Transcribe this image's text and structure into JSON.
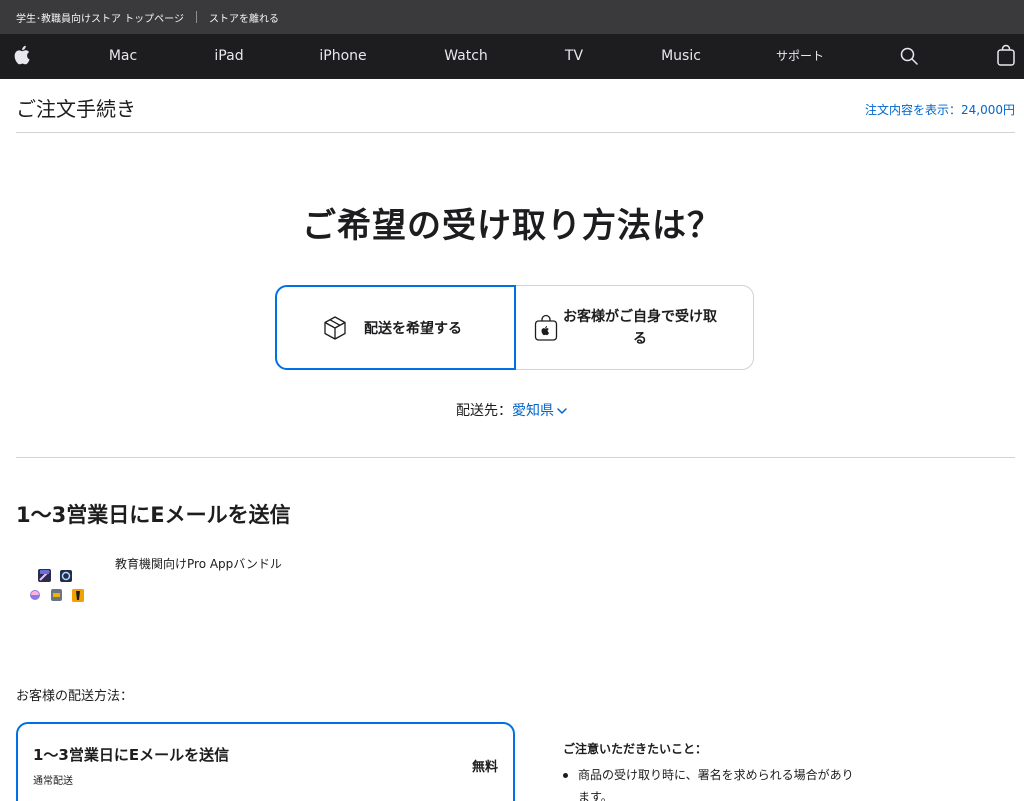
{
  "utility_bar": {
    "store_top_link": "学生･教職員向けストア トップページ",
    "leave_store_link": "ストアを離れる"
  },
  "global_nav": {
    "logo_icon": "apple-logo-icon",
    "items": [
      "Mac",
      "iPad",
      "iPhone",
      "Watch",
      "TV",
      "Music",
      "サポート"
    ],
    "search_icon": "search-icon",
    "bag_icon": "shopping-bag-icon"
  },
  "checkout": {
    "title": "ご注文手続き",
    "order_summary": "注文内容を表示：24,000円"
  },
  "delivery_question": "ご希望の受け取り方法は？",
  "delivery_options": {
    "ship": {
      "label": "配送を希望する",
      "icon": "box-icon",
      "selected": true
    },
    "pickup": {
      "label": "お客様がご自身で受け取る",
      "icon": "apple-store-bag-icon",
      "selected": false
    }
  },
  "destination": {
    "label": "配送先：",
    "value": "愛知県"
  },
  "shipment": {
    "heading": "1〜3営業日にEメールを送信",
    "product_name": "教育機関向けPro Appバンドル",
    "product_image": "pro-apps-bundle-icons"
  },
  "shipping_method": {
    "label": "お客様の配送方法：",
    "title": "1〜3営業日にEメールを送信",
    "subtitle": "通常配送",
    "price": "無料"
  },
  "notes": {
    "heading": "ご注意いただきたいこと：",
    "items": [
      "商品の受け取り時に、署名を求められる場合があります。"
    ]
  },
  "colors": {
    "accent": "#0071e3",
    "link": "#0066cc",
    "nav_bg": "#1d1d1f",
    "utility_bg": "#3a3a3c"
  }
}
